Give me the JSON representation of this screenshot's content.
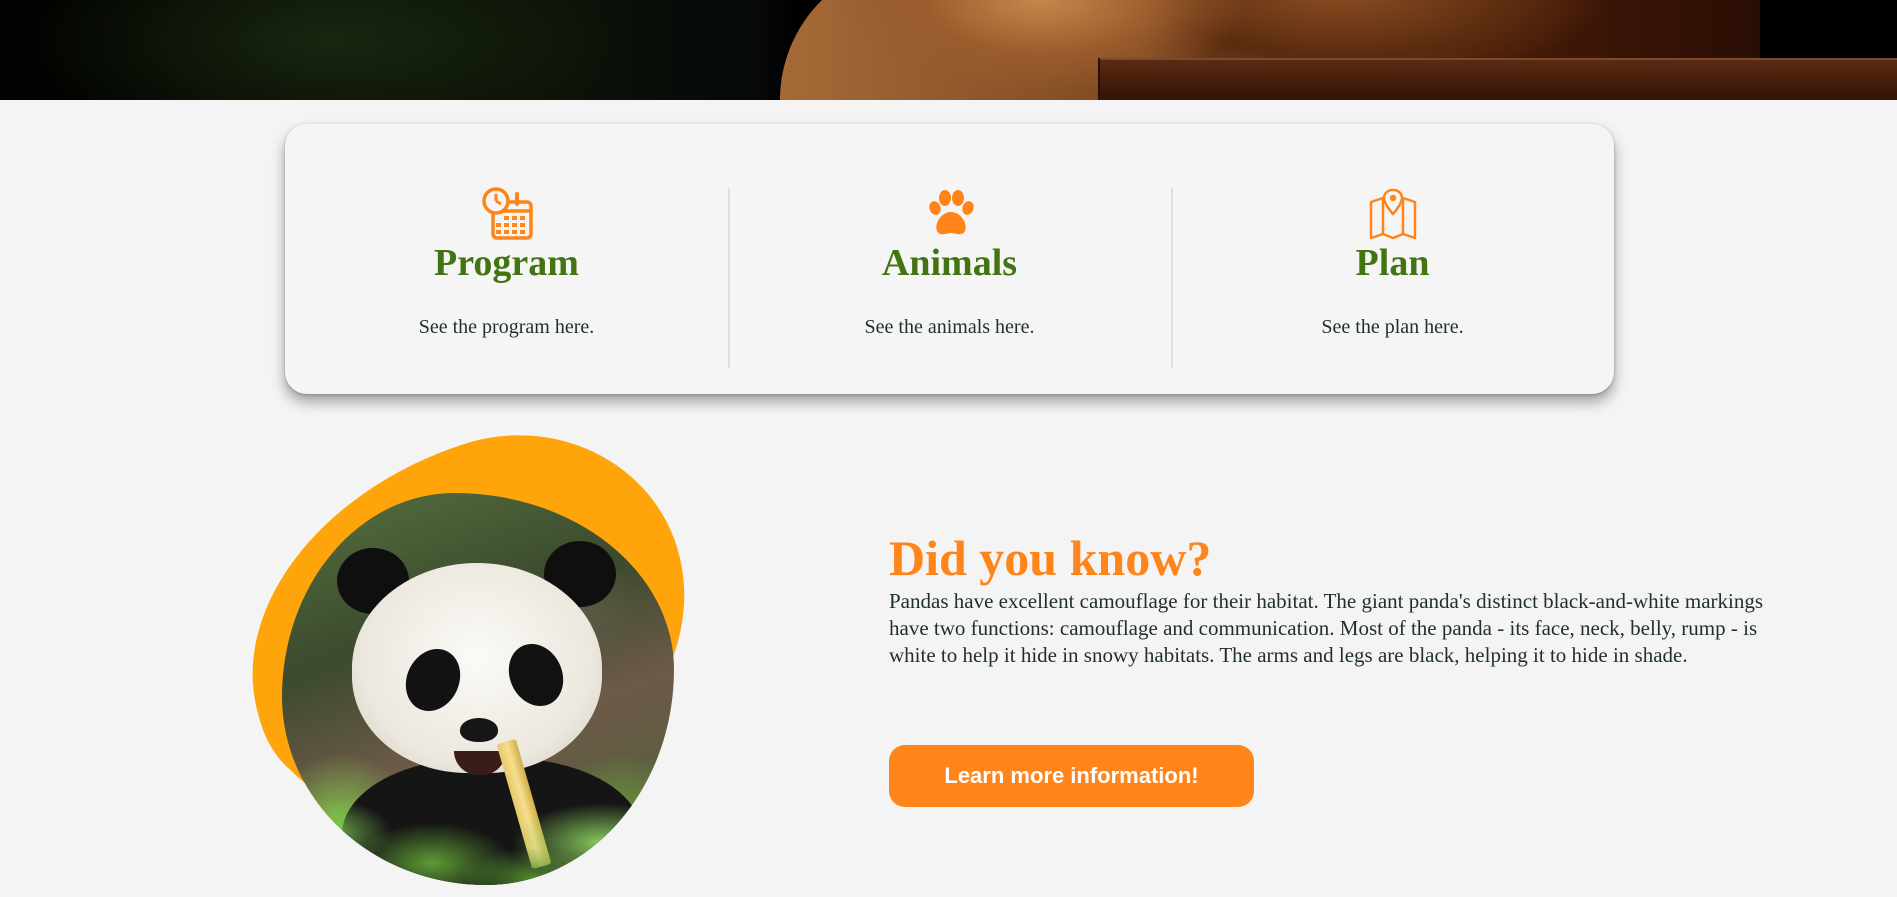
{
  "colors": {
    "page_background": "#f4f4f4",
    "feature_title": "#437412",
    "accent_orange": "#ff841a",
    "blob_orange": "#ffa40a",
    "body_text": "#1f2f2a"
  },
  "hero": {
    "image": "red-panda-photo"
  },
  "features": [
    {
      "icon": "calendar-clock-icon",
      "title": "Program",
      "description": "See the program here."
    },
    {
      "icon": "paw-icon",
      "title": "Animals",
      "description": "See the animals here."
    },
    {
      "icon": "map-pin-icon",
      "title": "Plan",
      "description": "See the plan here."
    }
  ],
  "did_you_know": {
    "image": "panda-photo",
    "heading": "Did you know?",
    "text": "Pandas have excellent camouflage for their habitat. The giant panda's distinct black-and-white markings have two functions: camouflage and communication. Most of the panda - its face, neck, belly, rump - is white to help it hide in snowy habitats. The arms and legs are black, helping it to hide in shade.",
    "button_label": "Learn more information!"
  }
}
